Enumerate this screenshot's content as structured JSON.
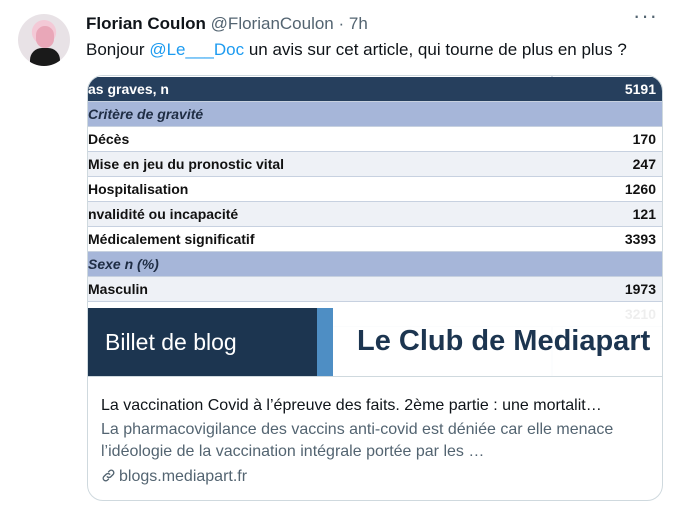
{
  "tweet": {
    "author_name": "Florian Coulon",
    "author_handle": "@FlorianCoulon",
    "separator": "·",
    "time": "7h",
    "more_label": "···",
    "text_before": "Bonjour ",
    "mention": "@Le___Doc",
    "text_after": " un avis sur cet article, qui tourne de plus en plus ?"
  },
  "card": {
    "table": {
      "rows": [
        {
          "label": "as graves, n",
          "value": "5191",
          "style": "head"
        },
        {
          "label": "Critère de gravité",
          "value": "",
          "style": "section"
        },
        {
          "label": "Décès",
          "value": "170",
          "style": "plain"
        },
        {
          "label": "Mise en jeu du pronostic vital",
          "value": "247",
          "style": "alt"
        },
        {
          "label": "Hospitalisation",
          "value": "1260",
          "style": "plain"
        },
        {
          "label": "nvalidité ou incapacité",
          "value": "121",
          "style": "alt"
        },
        {
          "label": "Médicalement significatif",
          "value": "3393",
          "style": "plain"
        },
        {
          "label": "Sexe n (%)",
          "value": "",
          "style": "section"
        },
        {
          "label": "Masculin",
          "value": "1973",
          "style": "alt"
        },
        {
          "label": "",
          "value": "3210",
          "style": "plain"
        }
      ]
    },
    "banner_left": "Billet de blog",
    "banner_right": "Le Club de Mediapart",
    "title": "La vaccination Covid à l’épreuve des faits. 2ème partie : une mortalit…",
    "description": "La pharmacovigilance des vaccins anti-covid est déniée car elle menace l’idéologie de la vaccination intégrale portée par les …",
    "domain": "blogs.mediapart.fr",
    "link_icon": "link-icon"
  }
}
